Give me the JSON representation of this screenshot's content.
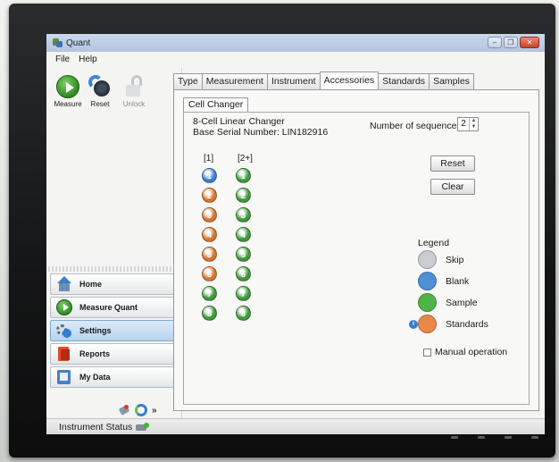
{
  "window": {
    "title": "Quant",
    "controls": [
      "minimize",
      "restore",
      "close"
    ]
  },
  "menu": {
    "items": [
      "File",
      "Help"
    ]
  },
  "toolbar": {
    "measure": {
      "label": "Measure",
      "icon": "play-icon"
    },
    "reset": {
      "label": "Reset",
      "icon": "reset-icon"
    },
    "unlock": {
      "label": "Unlock",
      "icon": "lock-icon",
      "enabled": false
    }
  },
  "nav": [
    {
      "label": "Home",
      "icon": "home-icon",
      "active": false
    },
    {
      "label": "Measure Quant",
      "icon": "play-icon",
      "active": false
    },
    {
      "label": "Settings",
      "icon": "settings-icon",
      "active": true
    },
    {
      "label": "Reports",
      "icon": "reports-icon",
      "active": false
    },
    {
      "label": "My Data",
      "icon": "mydata-icon",
      "active": false
    }
  ],
  "bottom_tools": {
    "chevron": "»"
  },
  "tabs": [
    {
      "label": "Type",
      "active": false
    },
    {
      "label": "Measurement",
      "active": false
    },
    {
      "label": "Instrument",
      "active": false
    },
    {
      "label": "Accessories",
      "active": true
    },
    {
      "label": "Standards",
      "active": false
    },
    {
      "label": "Samples",
      "active": false
    }
  ],
  "subtab": {
    "label": "Cell Changer"
  },
  "cell_changer": {
    "device_name": "8-Cell Linear Changer",
    "serial": "Base Serial Number: LIN182916",
    "sequences_label": "Number of sequences",
    "sequences_value": "2",
    "columns": [
      {
        "header": "[1]",
        "cells": [
          {
            "n": "1",
            "type": "blank"
          },
          {
            "n": "2",
            "type": "standards"
          },
          {
            "n": "3",
            "type": "standards"
          },
          {
            "n": "4",
            "type": "standards"
          },
          {
            "n": "5",
            "type": "standards"
          },
          {
            "n": "6",
            "type": "standards"
          },
          {
            "n": "7",
            "type": "sample"
          },
          {
            "n": "8",
            "type": "sample"
          }
        ]
      },
      {
        "header": "[2+]",
        "cells": [
          {
            "n": "1",
            "type": "sample"
          },
          {
            "n": "2",
            "type": "sample"
          },
          {
            "n": "3",
            "type": "sample"
          },
          {
            "n": "4",
            "type": "sample"
          },
          {
            "n": "5",
            "type": "sample"
          },
          {
            "n": "6",
            "type": "sample"
          },
          {
            "n": "7",
            "type": "sample"
          },
          {
            "n": "8",
            "type": "sample"
          }
        ]
      }
    ],
    "reset_label": "Reset",
    "clear_label": "Clear",
    "legend_title": "Legend",
    "legend": [
      {
        "label": "Skip",
        "color": "#c9ccd0"
      },
      {
        "label": "Blank",
        "color": "#4f8fd6"
      },
      {
        "label": "Sample",
        "color": "#4fb447"
      },
      {
        "label": "Standards",
        "color": "#e8894a"
      }
    ],
    "info_badge": "i",
    "manual_label": "Manual operation",
    "manual_checked": false
  },
  "cell_colors": {
    "blank": "#3f7fcf",
    "standards": "#d8752f",
    "sample": "#3f9a3a"
  },
  "status": {
    "label": "Instrument Status"
  }
}
